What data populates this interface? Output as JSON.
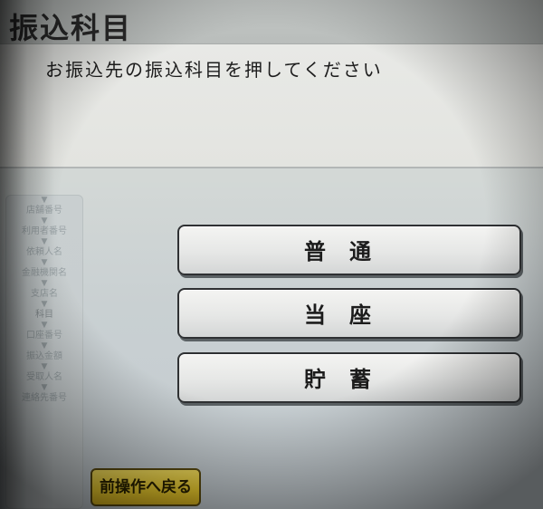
{
  "header": {
    "title": "振込科目"
  },
  "instruction": "お振込先の振込科目を押してください",
  "progress": {
    "steps": [
      "店舗番号",
      "利用者番号",
      "依頼人名",
      "金融機関名",
      "支店名",
      "科目",
      "口座番号",
      "振込金額",
      "受取人名",
      "連絡先番号"
    ]
  },
  "options": [
    {
      "label": "普通"
    },
    {
      "label": "当座"
    },
    {
      "label": "貯蓄"
    }
  ],
  "back_button": {
    "label": "前操作へ戻る"
  }
}
